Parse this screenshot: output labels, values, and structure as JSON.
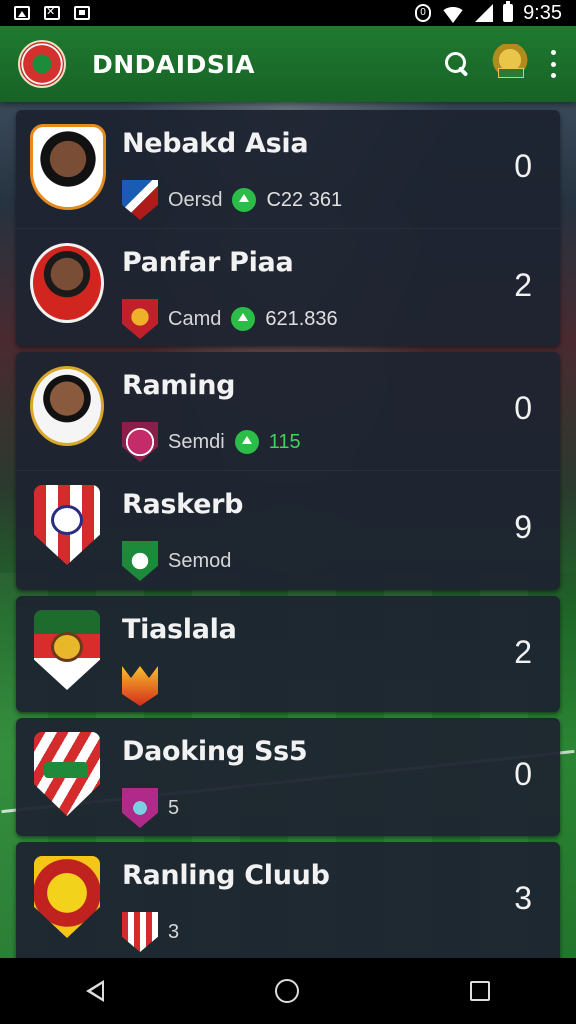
{
  "status_bar": {
    "time": "9:35",
    "left_icons": [
      "image-icon",
      "close-box-icon",
      "picture-icon"
    ],
    "right_icons": [
      "vibrate-icon",
      "wifi-icon",
      "signal-icon",
      "battery-icon"
    ]
  },
  "app_bar": {
    "title": "DNDAIDSIA",
    "actions": [
      "search-icon",
      "trophy-icon",
      "more-vert-icon"
    ]
  },
  "list": [
    {
      "name": "Nebakd Asia",
      "meta_label": "Oersd",
      "stat_value": "C22 361",
      "stat_icon": true,
      "score": "0"
    },
    {
      "name": "Panfar Piaa",
      "meta_label": "Camd",
      "stat_value": "621.836",
      "stat_icon": true,
      "score": "2"
    },
    {
      "name": "Raming",
      "meta_label": "Semdi",
      "stat_value": "115",
      "stat_icon": true,
      "score": "0"
    },
    {
      "name": "Raskerb",
      "meta_label": "Semod",
      "stat_value": "",
      "stat_icon": false,
      "score": "9"
    },
    {
      "name": "Tiaslala",
      "meta_label": "",
      "stat_value": "",
      "stat_icon": false,
      "score": "2"
    },
    {
      "name": "Daoking Ss5",
      "meta_label": "5",
      "stat_value": "",
      "stat_icon": false,
      "score": "0"
    },
    {
      "name": "Ranling Cluub",
      "meta_label": "3",
      "stat_value": "",
      "stat_icon": false,
      "score": "3"
    }
  ],
  "nav_bar": {
    "buttons": [
      "back-icon",
      "home-icon",
      "recents-icon"
    ]
  },
  "colors": {
    "app_bar": "#1f7a2f",
    "card": "#1e2430",
    "stat_green": "#3fd35a",
    "status_bar": "#000000"
  }
}
